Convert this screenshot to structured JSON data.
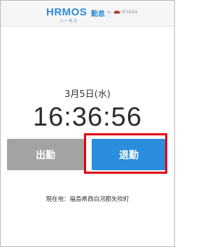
{
  "header": {
    "brand": "HRMOS",
    "brand_kana": "ハーモス",
    "product": "勤怠",
    "by": "by",
    "partner": "IEYASU"
  },
  "clock": {
    "date": "3月5日(水)",
    "time": "16:36:56"
  },
  "actions": {
    "clock_in_label": "出勤",
    "clock_out_label": "退勤",
    "highlight_color": "#e0000a"
  },
  "location": {
    "text": "現在地：福島県西白河郡矢吹町"
  },
  "colors": {
    "brand_blue": "#2b8bd9",
    "clock_out_button": "#2a8dde",
    "clock_in_button": "#a3a3a3"
  }
}
